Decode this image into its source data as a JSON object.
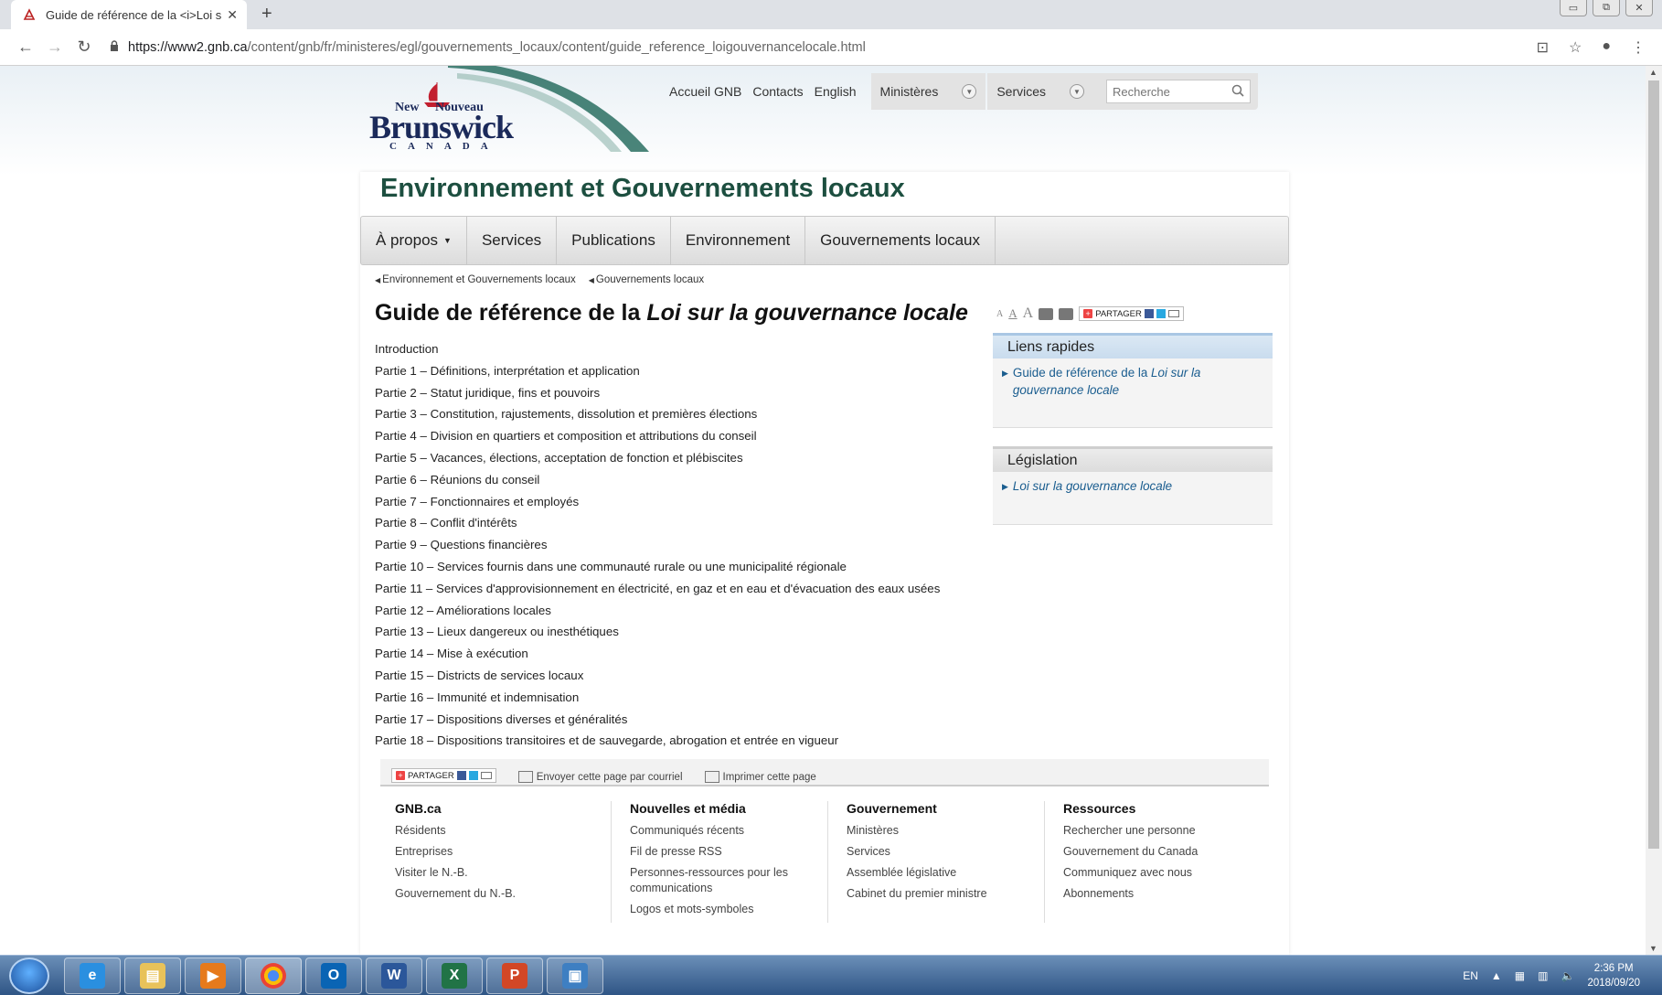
{
  "browser": {
    "tab_title": "Guide de référence de la <i>Loi s",
    "url_host": "https://www2.gnb.ca",
    "url_path": "/content/gnb/fr/ministeres/egl/gouvernements_locaux/content/guide_reference_loigouvernancelocale.html"
  },
  "logo": {
    "new": "New",
    "nouveau": "Nouveau",
    "brunswick": "Brunswick",
    "canada": "CANADA"
  },
  "topnav": {
    "links": [
      "Accueil GNB",
      "Contacts",
      "English"
    ],
    "ministeres": "Ministères",
    "services": "Services",
    "search_placeholder": "Recherche"
  },
  "dept_title": "Environnement et Gouvernements locaux",
  "mainnav": [
    "À propos",
    "Services",
    "Publications",
    "Environnement",
    "Gouvernements locaux"
  ],
  "breadcrumb": [
    "Environnement et Gouvernements locaux",
    "Gouvernements locaux"
  ],
  "page_title": {
    "prefix": "Guide de référence de la ",
    "italic": "Loi sur la gouvernance locale"
  },
  "toc": [
    "Introduction",
    "Partie 1 – Définitions, interprétation et application",
    "Partie 2 – Statut juridique, fins et pouvoirs",
    "Partie 3 – Constitution, rajustements, dissolution et premières élections",
    "Partie 4 – Division en quartiers et composition et attributions du conseil",
    "Partie 5 – Vacances, élections, acceptation de fonction et plébiscites",
    "Partie 6 – Réunions du conseil",
    "Partie 7 – Fonctionnaires et employés",
    "Partie 8 – Conflit d'intérêts",
    "Partie 9 – Questions financières",
    "Partie 10 – Services fournis dans une communauté rurale ou une municipalité régionale",
    "Partie 11 – Services d'approvisionnement en électricité, en gaz et en eau et d'évacuation des eaux usées",
    "Partie 12 – Améliorations locales",
    "Partie 13 – Lieux dangereux ou inesthétiques",
    "Partie 14 – Mise à exécution",
    "Partie 15 – Districts de services locaux",
    "Partie 16 – Immunité et indemnisation",
    "Partie 17 – Dispositions diverses et généralités",
    "Partie 18 – Dispositions transitoires et de sauvegarde, abrogation et entrée en vigueur"
  ],
  "share_label": "PARTAGER",
  "sidebar": {
    "quick_links": {
      "title": "Liens rapides",
      "link_prefix": "Guide de référence de la ",
      "link_italic": "Loi sur la gouvernance locale"
    },
    "legislation": {
      "title": "Législation",
      "link": "Loi sur la gouvernance locale"
    }
  },
  "footer_bar": {
    "share": "PARTAGER",
    "email": "Envoyer cette page par courriel",
    "print": "Imprimer cette page"
  },
  "footer": [
    {
      "title": "GNB.ca",
      "items": [
        "Résidents",
        "Entreprises",
        "Visiter le N.-B.",
        "Gouvernement du N.-B."
      ]
    },
    {
      "title": "Nouvelles et média",
      "items": [
        "Communiqués récents",
        "Fil de presse RSS",
        "Personnes-ressources pour les communications",
        "Logos et mots-symboles"
      ]
    },
    {
      "title": "Gouvernement",
      "items": [
        "Ministères",
        "Services",
        "Assemblée législative",
        "Cabinet du premier ministre"
      ]
    },
    {
      "title": "Ressources",
      "items": [
        "Rechercher une personne",
        "Gouvernement du Canada",
        "Communiquez avec nous",
        "Abonnements"
      ]
    }
  ],
  "taskbar": {
    "lang": "EN",
    "time": "2:36 PM",
    "date": "2018/09/20"
  },
  "colors": {
    "dept_green": "#1d4f40",
    "link_blue": "#1a5d8f",
    "quick_links_accent": "#a9c7e4",
    "legislation_accent": "#cfcfcf"
  }
}
